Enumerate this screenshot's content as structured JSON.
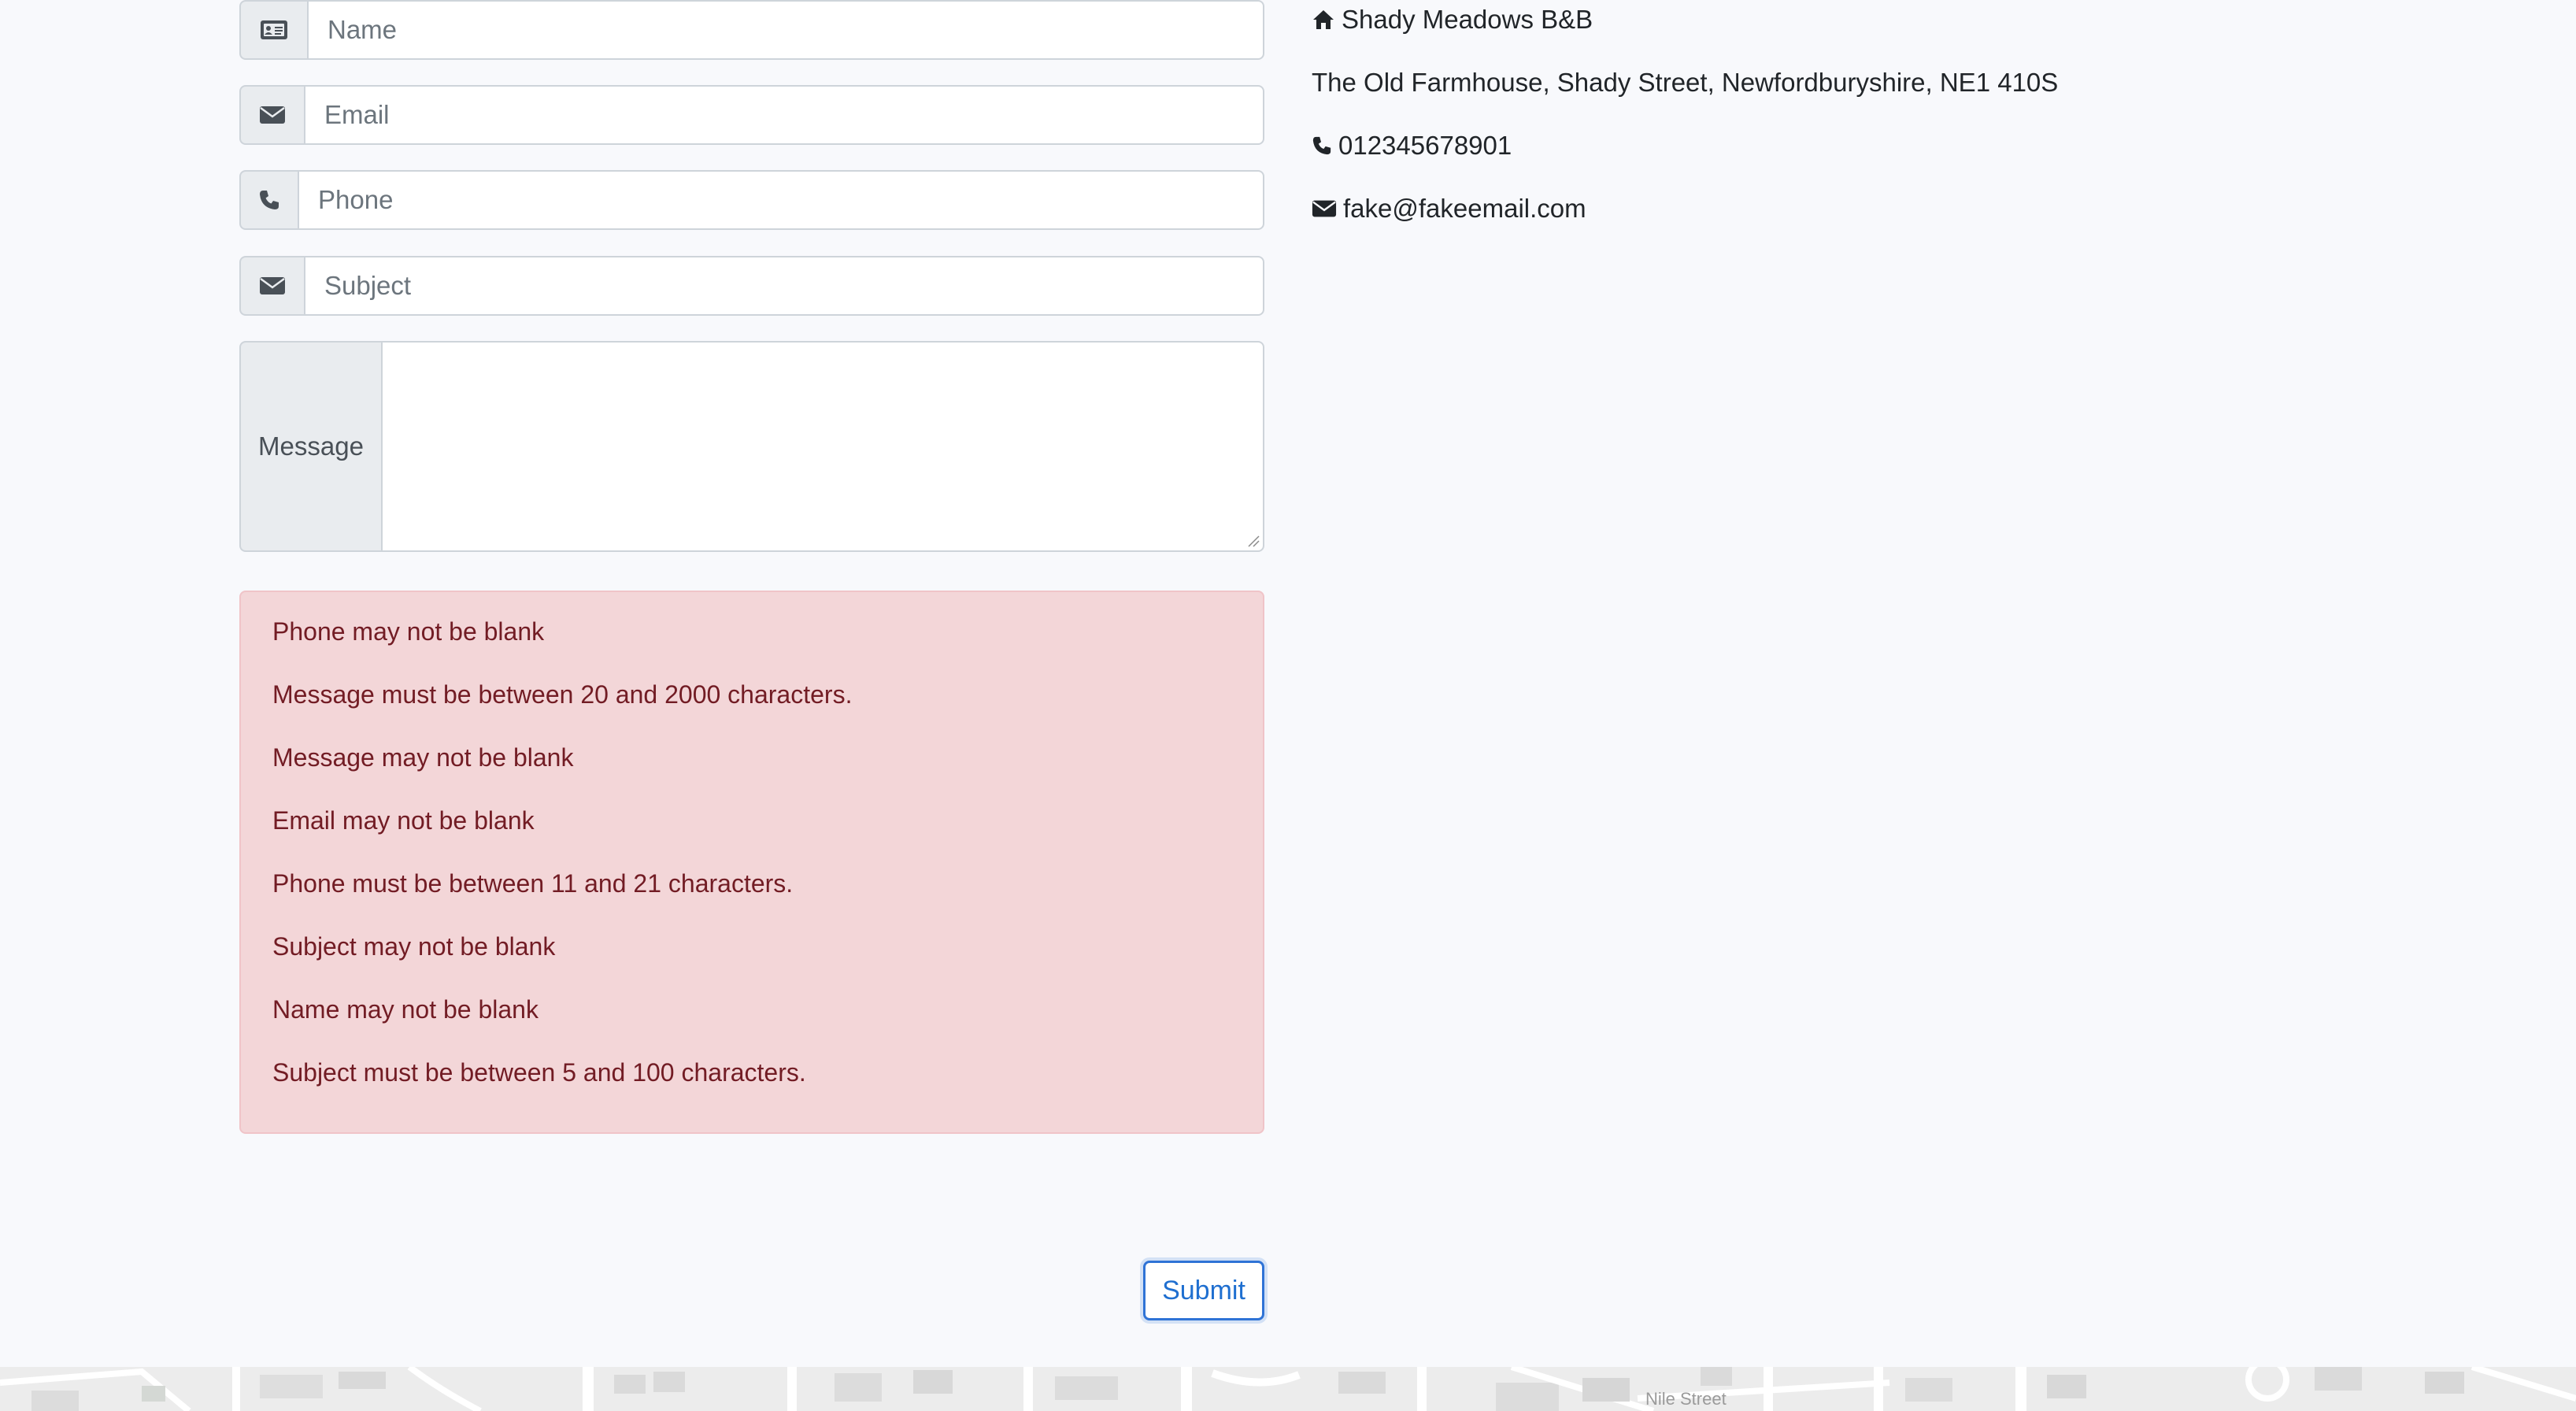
{
  "form": {
    "name_placeholder": "Name",
    "email_placeholder": "Email",
    "phone_placeholder": "Phone",
    "subject_placeholder": "Subject",
    "message_label": "Message",
    "submit_label": "Submit",
    "icons": {
      "name": "id-card-icon",
      "email": "envelope-icon",
      "phone": "phone-icon",
      "subject": "envelope-icon"
    }
  },
  "errors": [
    "Phone may not be blank",
    "Message must be between 20 and 2000 characters.",
    "Message may not be blank",
    "Email may not be blank",
    "Phone must be between 11 and 21 characters.",
    "Subject may not be blank",
    "Name may not be blank",
    "Subject must be between 5 and 100 characters."
  ],
  "contact": {
    "name": "Shady Meadows B&B",
    "address": "The Old Farmhouse, Shady Street, Newfordburyshire, NE1 410S",
    "phone": "012345678901",
    "email": "fake@fakeemail.com"
  },
  "map": {
    "street_label": "Nile Street"
  },
  "colors": {
    "page_bg": "#f8f9fc",
    "alert_bg": "#f3d6d8",
    "alert_text": "#721c24",
    "accent": "#2f73d6"
  }
}
